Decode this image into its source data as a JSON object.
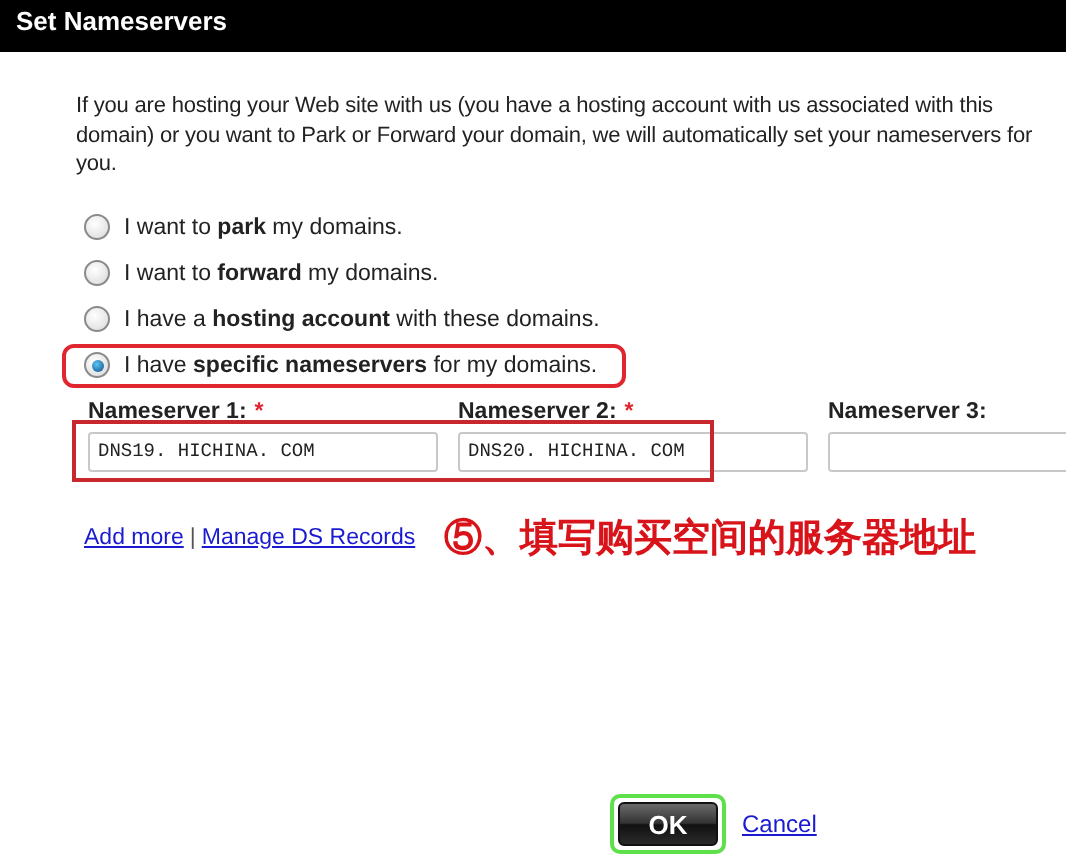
{
  "window": {
    "title": "Set Nameservers"
  },
  "intro": "If you are hosting your Web site with us (you have a hosting account with us associated with this domain) or you want to Park or Forward your domain, we will automatically set your nameservers for you.",
  "options": [
    {
      "label": "I want to **park** my domains.",
      "selected": false,
      "highlighted": false
    },
    {
      "label": "I want to **forward** my domains.",
      "selected": false,
      "highlighted": false
    },
    {
      "label": "I have a **hosting account** with these domains.",
      "selected": false,
      "highlighted": false
    },
    {
      "label": "I have **specific nameservers** for my domains.",
      "selected": true,
      "highlighted": true
    }
  ],
  "nameservers": {
    "highlighted": true,
    "fields": [
      {
        "label": "Nameserver 1:",
        "required_mark": "*",
        "value": "DNS19. HICHINA. COM"
      },
      {
        "label": "Nameserver 2:",
        "required_mark": "*",
        "value": "DNS20. HICHINA. COM"
      },
      {
        "label": "Nameserver 3:"
      }
    ]
  },
  "links": [
    {
      "label": "Add more"
    },
    {
      "label": "Manage DS Records"
    }
  ],
  "link_separator": "|",
  "annotation": "⑤、填写购买空间的服务器地址",
  "buttons": {
    "ok": {
      "label": "OK",
      "highlighted": true
    },
    "cancel": {
      "label": "Cancel"
    }
  }
}
